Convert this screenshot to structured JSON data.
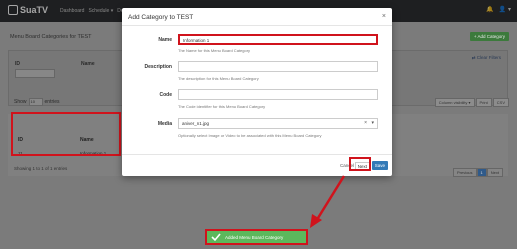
{
  "app": {
    "brand": "SuaTV"
  },
  "nav": {
    "links": [
      "Dashboard",
      "Schedule ▾",
      "De"
    ],
    "right": [
      "🔔",
      "👤 ▾"
    ]
  },
  "page": {
    "title": "Menu Board Categories for TEST",
    "add_button": "+ Add Category",
    "filters": {
      "id_label": "ID",
      "name_label": "Name",
      "clear": "⇄ Clear Filters"
    },
    "show_label": "Show",
    "show_value": "10",
    "entries_label": "entries",
    "tools": [
      "Column visibility ▾",
      "Print",
      "CSV"
    ],
    "table": {
      "headers": [
        "ID",
        "Name"
      ],
      "rows": [
        {
          "id": "11",
          "name": "Information 1"
        }
      ]
    },
    "showing": "Showing 1 to 1 of 1 entries",
    "pager": {
      "prev": "Previous",
      "page": "1",
      "next": "Next"
    }
  },
  "modal": {
    "title": "Add Category to TEST",
    "close": "×",
    "fields": {
      "name": {
        "label": "Name",
        "value": "Information 1",
        "help": "The Name for this Menu Board Category"
      },
      "description": {
        "label": "Description",
        "value": "",
        "help": "The description for this Menu Board Category"
      },
      "code": {
        "label": "Code",
        "value": "",
        "help": "The Code identifier for this Menu Board Category"
      },
      "media": {
        "label": "Media",
        "value": "aniver_n1.jpg",
        "help": "Optionally select Image or Video to be associated with this Menu Board Category"
      }
    },
    "buttons": {
      "cancel": "Cancel",
      "next": "Next",
      "save": "Save"
    }
  },
  "toast": {
    "text": "Added Menu Board Category"
  },
  "colors": {
    "highlight": "#d0131c",
    "toast": "#5cb85c",
    "primary": "#337ab7"
  }
}
